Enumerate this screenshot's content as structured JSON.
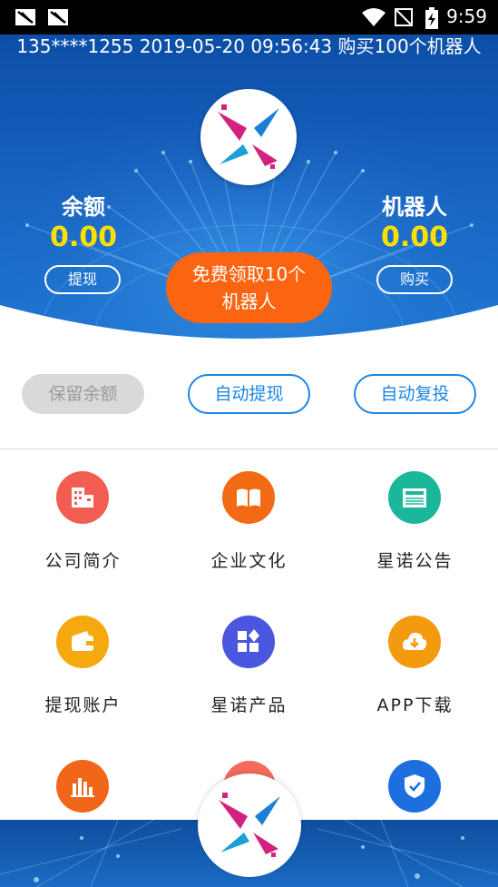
{
  "status_bar": {
    "time": "9:59",
    "icons": [
      "notification-icon",
      "notification-icon",
      "wifi-icon",
      "no-sim-icon",
      "battery-charging-icon"
    ]
  },
  "ticker": {
    "text": "135****1255 2019-05-20 09:56:43 购买100个机器人"
  },
  "balance": {
    "label": "余额",
    "value": "0.00",
    "button": "提现"
  },
  "robots": {
    "label": "机器人",
    "value": "0.00",
    "button": "购买"
  },
  "cta": {
    "line1": "免费领取10个",
    "line2": "机器人"
  },
  "actions": [
    {
      "label": "保留余额",
      "state": "disabled"
    },
    {
      "label": "自动提现",
      "state": "active"
    },
    {
      "label": "自动复投",
      "state": "active"
    }
  ],
  "grid": [
    {
      "label": "公司简介",
      "icon": "building-icon",
      "color": "#f25d51"
    },
    {
      "label": "企业文化",
      "icon": "book-icon",
      "color": "#f26a13"
    },
    {
      "label": "星诺公告",
      "icon": "news-icon",
      "color": "#1bb79a"
    },
    {
      "label": "提现账户",
      "icon": "wallet-icon",
      "color": "#f5a90f"
    },
    {
      "label": "星诺产品",
      "icon": "apps-icon",
      "color": "#4a55e0"
    },
    {
      "label": "APP下载",
      "icon": "cloud-download-icon",
      "color": "#f39a0e"
    },
    {
      "label": "",
      "icon": "bar-chart-icon",
      "color": "#f2661a"
    },
    {
      "label": "",
      "icon": "shield-check-icon",
      "color": "#1d6fe0"
    }
  ],
  "colors": {
    "header_blue": "#1761be",
    "accent_yellow": "#ffe000",
    "cta_orange": "#fb6410",
    "action_blue": "#1b86e6"
  }
}
